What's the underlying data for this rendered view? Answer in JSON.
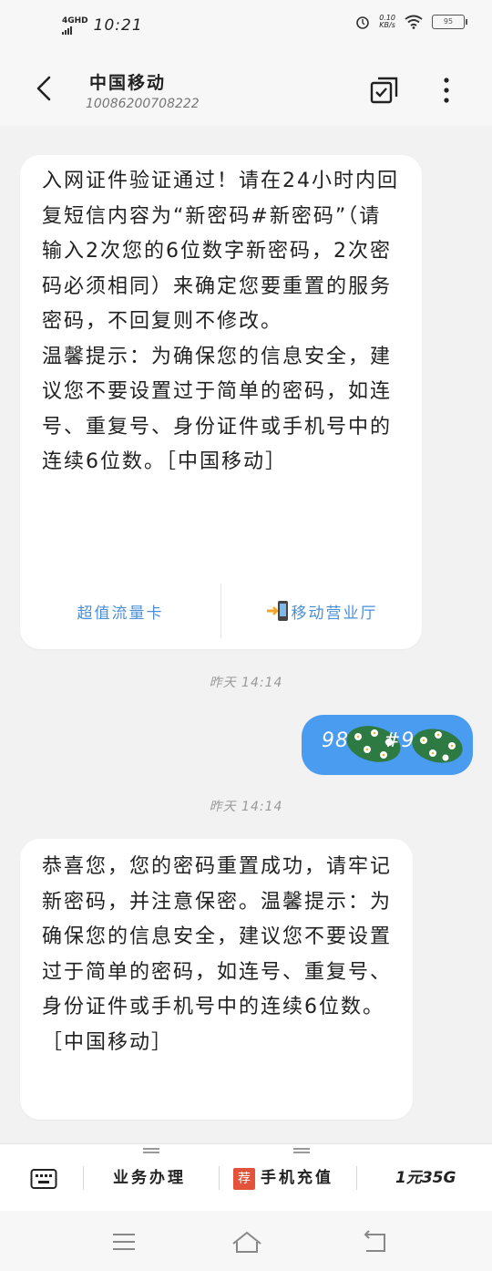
{
  "status_bar": {
    "network": "4GHD",
    "time": "10:21",
    "speed": "0.10",
    "speed_unit": "KB/s",
    "battery": "95"
  },
  "header": {
    "contact_name": "中国移动",
    "contact_number": "10086200708222"
  },
  "messages": {
    "m1": {
      "paragraph_1": "入网证件验证通过！请在24小时内回复短信内容为“新密码#新密码”（请输入2次您的6位数字新密码，2次密码必须相同）来确定您要重置的服务密码，不回复则不修改。",
      "paragraph_2": "温馨提示：为确保您的信息安全，建议您不要设置过于简单的密码，如连号、重复号、身份证件或手机号中的连续6位数。［中国移动］",
      "action_left": "超值流量卡",
      "action_right": "移动营业厅"
    },
    "ts1": "昨天 14:14",
    "sent": {
      "prefix": "98",
      "middle": "#98"
    },
    "ts2": "昨天 14:14",
    "m2": {
      "text": "恭喜您，您的密码重置成功，请牢记新密码，并注意保密。温馨提示：为确保您的信息安全，建议您不要设置过于简单的密码，如连号、重复号、身份证件或手机号中的连续6位数。［中国移动］"
    }
  },
  "menu": {
    "item1": "业务办理",
    "badge": "荐",
    "item2": "手机充值",
    "item3": "1元35G"
  },
  "colors": {
    "accent": "#4a9cf0",
    "link": "#4a8fd6",
    "badge": "#e3533c"
  }
}
